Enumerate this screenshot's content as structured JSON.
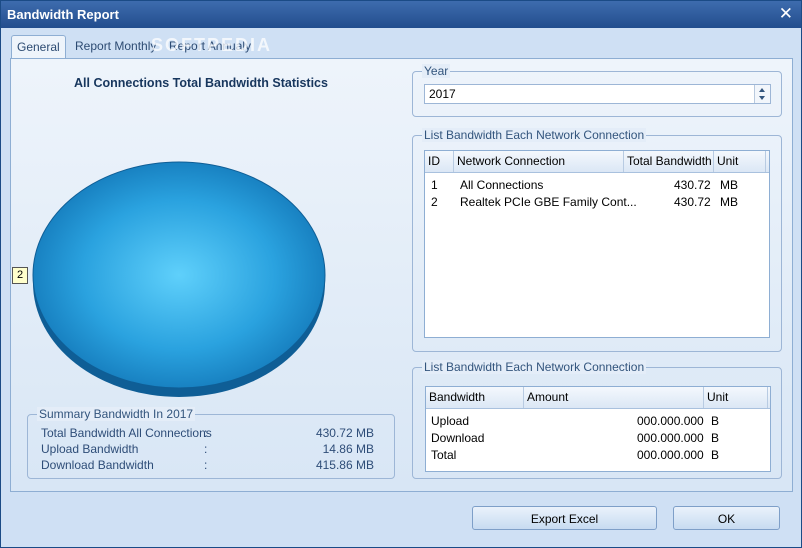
{
  "window": {
    "title": "Bandwidth Report",
    "close_glyph": "✕"
  },
  "tabs": [
    {
      "label": "General",
      "active": true
    },
    {
      "label": "Report Monthly",
      "active": false
    },
    {
      "label": "Report Annualy",
      "active": false
    }
  ],
  "watermark": "SOFTPEDIA",
  "chart": {
    "title": "All Connections Total Bandwidth Statistics",
    "slice_label": "2",
    "color": "#2ea6e3"
  },
  "chart_data": {
    "type": "pie",
    "title": "All Connections Total Bandwidth Statistics",
    "categories": [
      "2"
    ],
    "values": [
      100
    ]
  },
  "summary": {
    "legend": "Summary Bandwidth In 2017",
    "rows": [
      {
        "label": "Total Bandwidth All Connections",
        "colon": ":",
        "value": "430.72 MB"
      },
      {
        "label": "Upload Bandwidth",
        "colon": ":",
        "value": "14.86 MB"
      },
      {
        "label": "Download Bandwidth",
        "colon": ":",
        "value": "415.86 MB"
      }
    ]
  },
  "year": {
    "legend": "Year",
    "value": "2017"
  },
  "connections": {
    "legend": "List Bandwidth Each Network Connection",
    "columns": [
      "ID",
      "Network Connection",
      "Total Bandwidth",
      "Unit"
    ],
    "rows": [
      [
        "1",
        "All Connections",
        "430.72",
        "MB"
      ],
      [
        "2",
        "Realtek PCIe GBE Family Cont...",
        "430.72",
        "MB"
      ]
    ]
  },
  "bandwidth": {
    "legend": "List Bandwidth Each Network Connection",
    "columns": [
      "Bandwidth",
      "Amount",
      "Unit"
    ],
    "rows": [
      [
        "Upload",
        "000.000.000",
        "B"
      ],
      [
        "Download",
        "000.000.000",
        "B"
      ],
      [
        "Total",
        "000.000.000",
        "B"
      ]
    ]
  },
  "buttons": {
    "export": "Export Excel",
    "ok": "OK"
  }
}
